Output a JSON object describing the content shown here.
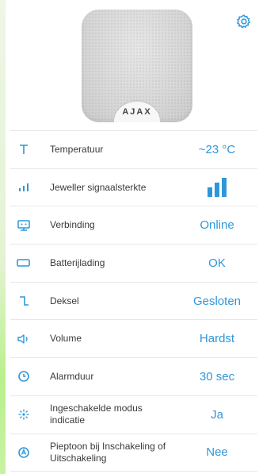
{
  "brand": "AJAX",
  "settings": {
    "icon": "gear-icon"
  },
  "accent_color": "#2f97d9",
  "rows": [
    {
      "icon": "temperature-icon",
      "label": "Temperatuur",
      "value": "~23 °C"
    },
    {
      "icon": "signal-strength-icon",
      "label": "Jeweller signaalsterkte",
      "value": "",
      "signal_bars": 3,
      "signal_max": 3
    },
    {
      "icon": "connection-icon",
      "label": "Verbinding",
      "value": "Online"
    },
    {
      "icon": "battery-icon",
      "label": "Batterijlading",
      "value": "OK"
    },
    {
      "icon": "lid-icon",
      "label": "Deksel",
      "value": "Gesloten"
    },
    {
      "icon": "volume-icon",
      "label": "Volume",
      "value": "Hardst"
    },
    {
      "icon": "clock-icon",
      "label": "Alarmduur",
      "value": "30 sec"
    },
    {
      "icon": "armed-mode-icon",
      "label": "Ingeschakelde modus indicatie",
      "value": "Ja"
    },
    {
      "icon": "beep-icon",
      "label": "Pieptoon bij Inschakeling of Uitschakeling",
      "value": "Nee"
    }
  ]
}
